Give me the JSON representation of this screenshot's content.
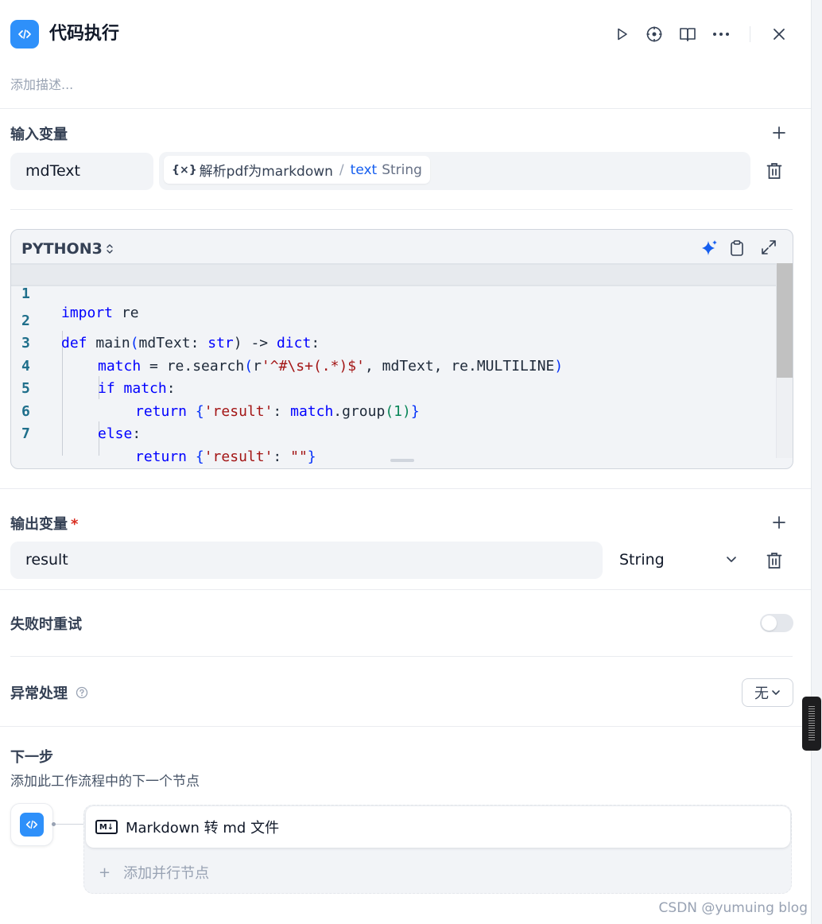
{
  "header": {
    "title": "代码执行",
    "description_placeholder": "添加描述...",
    "icons": [
      "code-icon",
      "play-icon",
      "locate-icon",
      "book-icon",
      "more-icon",
      "close-icon"
    ]
  },
  "input_section": {
    "title": "输入变量",
    "variable_name": "mdText",
    "ref_node": "解析pdf为markdown",
    "ref_separator": "/",
    "ref_var": "text",
    "ref_type": "String"
  },
  "code": {
    "language": "PYTHON3",
    "lines": [
      {
        "num": "1"
      },
      {
        "num": "2"
      },
      {
        "num": "3"
      },
      {
        "num": "4"
      },
      {
        "num": "5"
      },
      {
        "num": "6"
      },
      {
        "num": "7"
      }
    ],
    "tokens": {
      "l1": [
        "import",
        " re"
      ],
      "l2": [
        "def",
        " main",
        "(",
        "mdText: ",
        "str",
        ") -> ",
        "dict",
        ":"
      ],
      "l3": [
        "match",
        " = re.search",
        "(",
        "r",
        "'^#\\s+(.*)$'",
        ", mdText, re.MULTILINE",
        ")"
      ],
      "l4": [
        "if",
        " ",
        "match",
        ":"
      ],
      "l5": [
        "return",
        " ",
        "{",
        "'result'",
        ": ",
        "match",
        ".group",
        "(",
        "1",
        ")",
        "}"
      ],
      "l6": [
        "else",
        ":"
      ],
      "l7": [
        "return",
        " ",
        "{",
        "'result'",
        ": ",
        "\"\"",
        "}"
      ]
    }
  },
  "output_section": {
    "title": "输出变量",
    "required_mark": "*",
    "variable_name": "result",
    "type": "String"
  },
  "retry": {
    "title": "失败时重试",
    "enabled": false
  },
  "error_handling": {
    "title": "异常处理",
    "value": "无"
  },
  "next_step": {
    "title": "下一步",
    "subtitle": "添加此工作流程中的下一个节点",
    "next_node_label": "Markdown 转 md 文件",
    "next_node_icon_text": "M↓",
    "add_parallel": "添加并行节点",
    "add_symbol": "+"
  },
  "watermark": "CSDN @yumuing blog",
  "colors": {
    "accent": "#2e90fa",
    "link": "#155eef",
    "required": "#d92d20"
  }
}
